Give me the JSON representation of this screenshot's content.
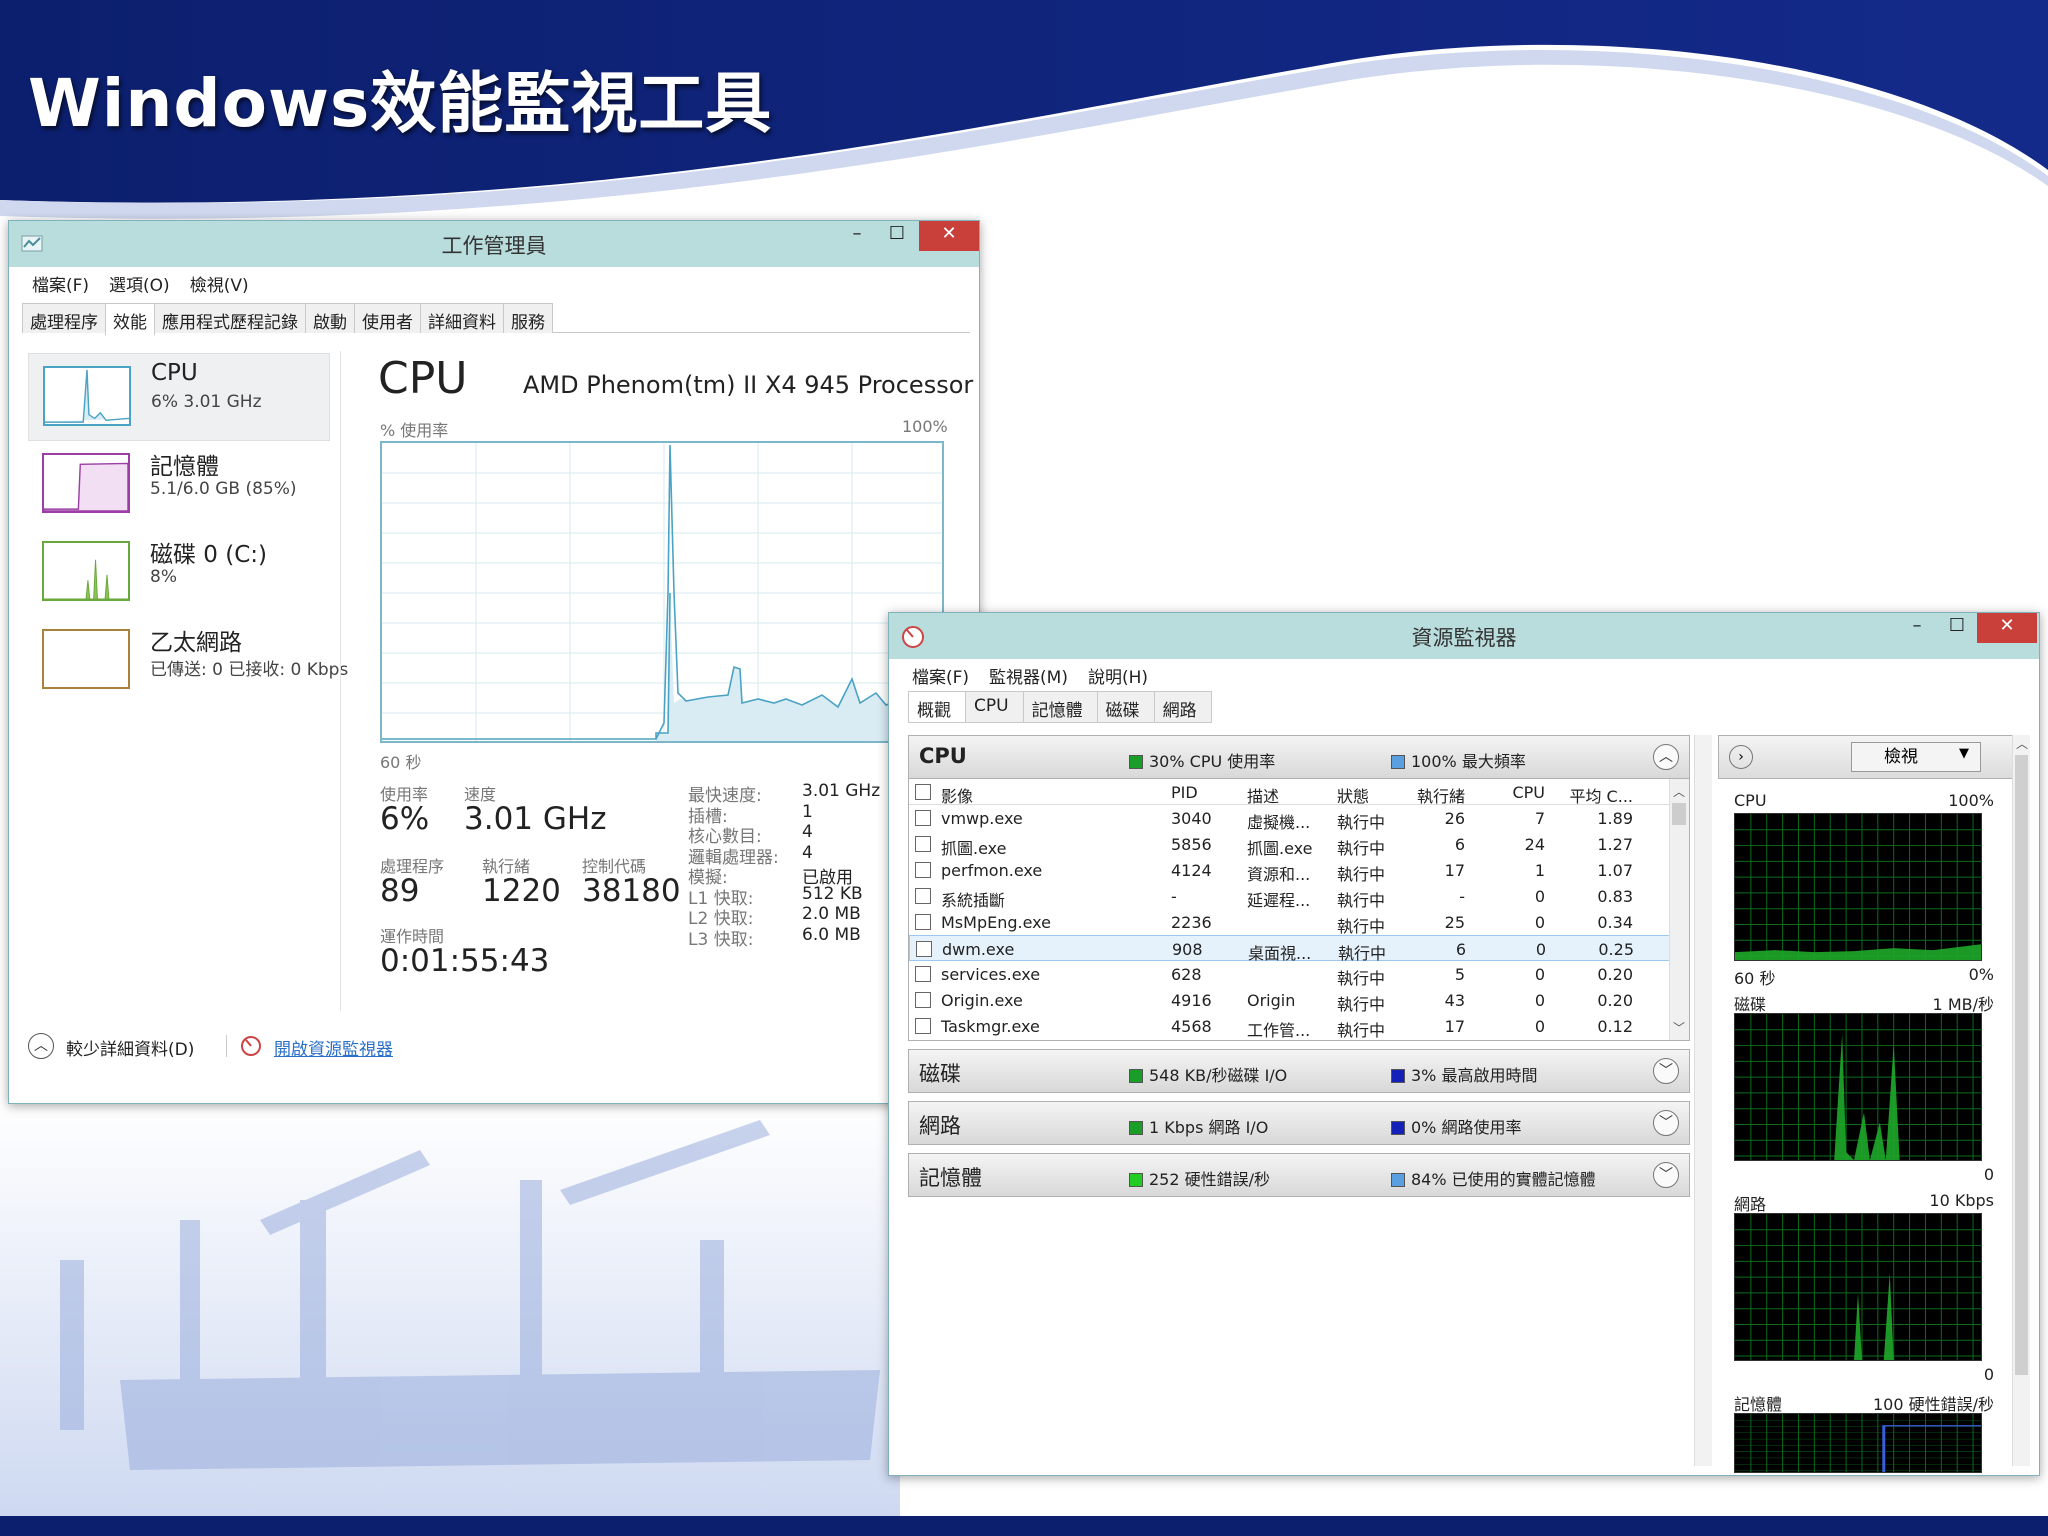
{
  "slide": {
    "title": "Windows效能監視工具"
  },
  "task_manager": {
    "title": "工作管理員",
    "window_controls": {
      "minimize": "–",
      "maximize": "☐",
      "close": "✕"
    },
    "menu": [
      "檔案(F)",
      "選項(O)",
      "檢視(V)"
    ],
    "tabs": [
      "處理程序",
      "效能",
      "應用程式歷程記錄",
      "啟動",
      "使用者",
      "詳細資料",
      "服務"
    ],
    "sidebar": [
      {
        "label": "CPU",
        "sub": "6%  3.01 GHz",
        "color": "#4aa3c4"
      },
      {
        "label": "記憶體",
        "sub": "5.1/6.0 GB (85%)",
        "color": "#9b3ea5"
      },
      {
        "label": "磁碟 0 (C:)",
        "sub": "8%",
        "color": "#69a83a"
      },
      {
        "label": "乙太網路",
        "sub": "已傳送: 0 已接收: 0 Kbps",
        "color": "#a8813a"
      }
    ],
    "cpu_heading": "CPU",
    "cpu_model": "AMD Phenom(tm) II X4 945 Processor",
    "chart_ylabel": "% 使用率",
    "chart_ymax": "100%",
    "chart_xlabel": "60 秒",
    "chart_color": "#4aa3c4",
    "stats": {
      "usage_label": "使用率",
      "usage": "6%",
      "speed_label": "速度",
      "speed": "3.01 GHz",
      "proc_label": "處理程序",
      "proc": "89",
      "threads_label": "執行緒",
      "threads": "1220",
      "handles_label": "控制代碼",
      "handles": "38180",
      "uptime_label": "運作時間",
      "uptime": "0:01:55:43"
    },
    "specs": [
      {
        "label": "最快速度:",
        "value": "3.01 GHz"
      },
      {
        "label": "插槽:",
        "value": "1"
      },
      {
        "label": "核心數目:",
        "value": "4"
      },
      {
        "label": "邏輯處理器:",
        "value": "4"
      },
      {
        "label": "模擬:",
        "value": "已啟用"
      },
      {
        "label": "L1 快取:",
        "value": "512 KB"
      },
      {
        "label": "L2 快取:",
        "value": "2.0 MB"
      },
      {
        "label": "L3 快取:",
        "value": "6.0 MB"
      }
    ],
    "footer": {
      "fewer_details": "較少詳細資料(D)",
      "open_resmon": "開啟資源監視器"
    }
  },
  "resource_monitor": {
    "title": "資源監視器",
    "window_controls": {
      "minimize": "–",
      "maximize": "☐",
      "close": "✕"
    },
    "menu": [
      "檔案(F)",
      "監視器(M)",
      "說明(H)"
    ],
    "tabs": [
      "概觀",
      "CPU",
      "記憶體",
      "磁碟",
      "網路"
    ],
    "cpu_section": {
      "title": "CPU",
      "legend1": "30% CPU 使用率",
      "legend1_color": "#1a9e2a",
      "legend2": "100% 最大頻率",
      "legend2_color": "#5aa0e0"
    },
    "columns": [
      "影像",
      "PID",
      "描述",
      "狀態",
      "執行緒",
      "CPU",
      "平均 C..."
    ],
    "processes": [
      [
        "vmwp.exe",
        "3040",
        "虛擬機...",
        "執行中",
        "26",
        "7",
        "1.89"
      ],
      [
        "抓圖.exe",
        "5856",
        "抓圖.exe",
        "執行中",
        "6",
        "24",
        "1.27"
      ],
      [
        "perfmon.exe",
        "4124",
        "資源和...",
        "執行中",
        "17",
        "1",
        "1.07"
      ],
      [
        "系統插斷",
        "-",
        "延遲程...",
        "執行中",
        "-",
        "0",
        "0.83"
      ],
      [
        "MsMpEng.exe",
        "2236",
        "",
        "執行中",
        "25",
        "0",
        "0.34"
      ],
      [
        "dwm.exe",
        "908",
        "桌面視...",
        "執行中",
        "6",
        "0",
        "0.25"
      ],
      [
        "services.exe",
        "628",
        "",
        "執行中",
        "5",
        "0",
        "0.20"
      ],
      [
        "Origin.exe",
        "4916",
        "Origin",
        "執行中",
        "43",
        "0",
        "0.20"
      ],
      [
        "Taskmgr.exe",
        "4568",
        "工作管...",
        "執行中",
        "17",
        "0",
        "0.12"
      ]
    ],
    "selected_row": 5,
    "disk_section": {
      "title": "磁碟",
      "legend1": "548 KB/秒磁碟 I/O",
      "legend1_color": "#1a9e2a",
      "legend2": "3% 最高啟用時間",
      "legend2_color": "#1420b8"
    },
    "net_section": {
      "title": "網路",
      "legend1": "1 Kbps 網路 I/O",
      "legend1_color": "#1a9e2a",
      "legend2": "0% 網路使用率",
      "legend2_color": "#1420b8"
    },
    "mem_section": {
      "title": "記憶體",
      "legend1": "252 硬性錯誤/秒",
      "legend1_color": "#22cc22",
      "legend2": "84% 已使用的實體記憶體",
      "legend2_color": "#5aa0e0"
    },
    "view_button": "檢視",
    "graphs": [
      {
        "name": "CPU",
        "max": "100%",
        "min_left": "60 秒",
        "min_right": "0%"
      },
      {
        "name": "磁碟",
        "max": "1 MB/秒",
        "min_left": "",
        "min_right": "0"
      },
      {
        "name": "網路",
        "max": "10 Kbps",
        "min_left": "",
        "min_right": "0"
      },
      {
        "name": "記憶體",
        "max": "100 硬性錯誤/秒",
        "min_left": "",
        "min_right": ""
      }
    ]
  }
}
